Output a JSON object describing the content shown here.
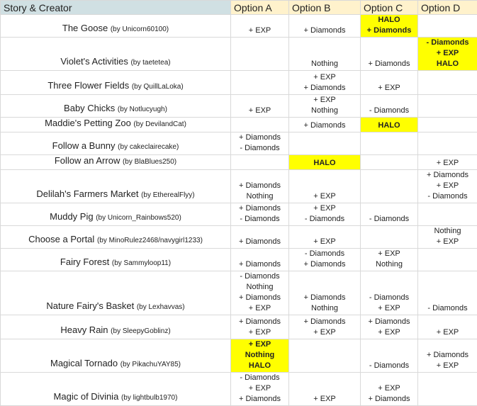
{
  "headers": [
    "Story & Creator",
    "Option A",
    "Option B",
    "Option C",
    "Option D"
  ],
  "highlight_color": "#ffff00",
  "rows": [
    {
      "title": "The Goose",
      "creator": "(by Unicorn60100)",
      "a": [
        "+ EXP"
      ],
      "b": [
        "+ Diamonds"
      ],
      "c": [
        "HALO",
        "+ Diamonds"
      ],
      "d": [],
      "hl": "c"
    },
    {
      "title": "Violet's Activities",
      "creator": "(by taetetea)",
      "a": [],
      "b": [
        "Nothing"
      ],
      "c": [
        "+ Diamonds"
      ],
      "d": [
        "- Diamonds",
        "+ EXP",
        "HALO"
      ],
      "hl": "d"
    },
    {
      "title": "Three Flower Fields",
      "creator": "(by QuillLaLoka)",
      "a": [],
      "b": [
        "+ EXP",
        "+ Diamonds"
      ],
      "c": [
        "+ EXP"
      ],
      "d": [],
      "hl": ""
    },
    {
      "title": "Baby Chicks",
      "creator": "(by Notlucyugh)",
      "a": [
        "+ EXP"
      ],
      "b": [
        "+ EXP",
        "Nothing"
      ],
      "c": [
        "- Diamonds"
      ],
      "d": [],
      "hl": ""
    },
    {
      "title": "Maddie's Petting Zoo",
      "creator": "(by DevilandCat)",
      "a": [],
      "b": [
        "+ Diamonds"
      ],
      "c": [
        "HALO"
      ],
      "d": [],
      "hl": "c"
    },
    {
      "title": "Follow a Bunny",
      "creator": "(by cakeclairecake)",
      "a": [
        "+ Diamonds",
        "- Diamonds"
      ],
      "b": [],
      "c": [],
      "d": [],
      "hl": ""
    },
    {
      "title": "Follow an Arrow",
      "creator": "(by BlaBlues250)",
      "a": [],
      "b": [
        "HALO"
      ],
      "c": [],
      "d": [
        "+ EXP"
      ],
      "hl": "b"
    },
    {
      "title": "Delilah's Farmers Market",
      "creator": "(by EtherealFlyy)",
      "a": [
        "+ Diamonds",
        "Nothing"
      ],
      "b": [
        "+ EXP"
      ],
      "c": [],
      "d": [
        "+ Diamonds",
        "+ EXP",
        "- Diamonds"
      ],
      "hl": ""
    },
    {
      "title": "Muddy Pig",
      "creator": "(by Unicorn_Rainbows520)",
      "a": [
        "+ Diamonds",
        "- Diamonds"
      ],
      "b": [
        "+ EXP",
        "- Diamonds"
      ],
      "c": [
        "- Diamonds"
      ],
      "d": [],
      "hl": ""
    },
    {
      "title": "Choose a Portal",
      "creator": "(by MinoRulez2468/navygirl1233)",
      "a": [
        "+ Diamonds"
      ],
      "b": [
        "+ EXP"
      ],
      "c": [],
      "d": [
        "Nothing",
        "+ EXP"
      ],
      "hl": ""
    },
    {
      "title": "Fairy Forest",
      "creator": "(by Sammyloop11)",
      "a": [
        "+ Diamonds"
      ],
      "b": [
        "- Diamonds",
        "+ Diamonds"
      ],
      "c": [
        "+ EXP",
        "Nothing"
      ],
      "d": [],
      "hl": ""
    },
    {
      "title": "Nature Fairy's Basket",
      "creator": "(by Lexhavvas)",
      "a": [
        "- Diamonds",
        "Nothing",
        "+ Diamonds",
        "+ EXP"
      ],
      "b": [
        "+ Diamonds",
        "Nothing"
      ],
      "c": [
        "- Diamonds",
        "+ EXP"
      ],
      "d": [
        "- Diamonds"
      ],
      "hl": ""
    },
    {
      "title": "Heavy Rain",
      "creator": "(by SleepyGoblinz)",
      "a": [
        "+ Diamonds",
        "+ EXP"
      ],
      "b": [
        "+ Diamonds",
        "+ EXP"
      ],
      "c": [
        "+ Diamonds",
        "+ EXP"
      ],
      "d": [
        "+ EXP"
      ],
      "hl": ""
    },
    {
      "title": "Magical Tornado",
      "creator": "(by PikachuYAY85)",
      "a": [
        "+ EXP",
        "Nothing",
        "HALO"
      ],
      "b": [],
      "c": [
        "- Diamonds"
      ],
      "d": [
        "+ Diamonds",
        "+ EXP"
      ],
      "hl": "a"
    },
    {
      "title": "Magic of Divinia",
      "creator": "(by lightbulb1970)",
      "a": [
        "- Diamonds",
        "+ EXP",
        "+ Diamonds"
      ],
      "b": [
        "+ EXP"
      ],
      "c": [
        "+ EXP",
        "+ Diamonds"
      ],
      "d": [],
      "hl": ""
    }
  ]
}
